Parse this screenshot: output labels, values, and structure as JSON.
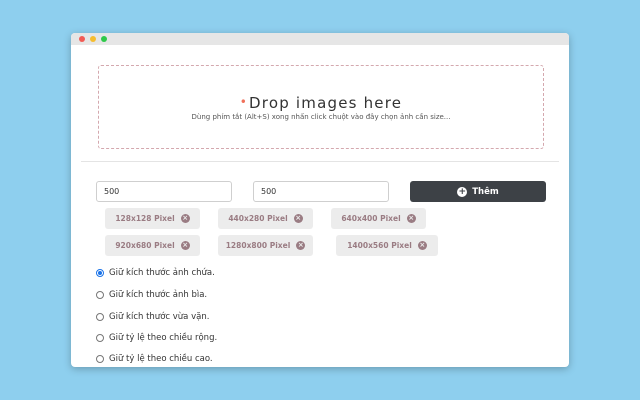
{
  "dropzone": {
    "title": "Drop images here",
    "subtitle": "Dùng phím tắt (Alt+S) xong nhấn click chuột vào đây chọn ảnh cần size..."
  },
  "size_inputs": {
    "width_value": "500",
    "height_value": "500"
  },
  "add_button": {
    "label": "Thêm"
  },
  "presets": [
    {
      "label": "128x128 Pixel"
    },
    {
      "label": "440x280 Pixel"
    },
    {
      "label": "640x400 Pixel"
    },
    {
      "label": "920x680 Pixel"
    },
    {
      "label": "1280x800 Pixel"
    },
    {
      "label": "1400x560 Pixel"
    }
  ],
  "resize_modes": [
    {
      "label": "Giữ kích thước ảnh chứa.",
      "checked": true
    },
    {
      "label": "Giữ kích thước ảnh bìa.",
      "checked": false
    },
    {
      "label": "Giữ kích thước vừa vặn.",
      "checked": false
    },
    {
      "label": "Giữ tỷ lệ theo chiều rộng.",
      "checked": false
    },
    {
      "label": "Giữ tỷ lệ theo chiều cao.",
      "checked": false
    }
  ],
  "colors": {
    "background": "#8ecfee",
    "button": "#3d4146",
    "chip_text": "#9a7c83",
    "radio_accent": "#1a73e8"
  }
}
